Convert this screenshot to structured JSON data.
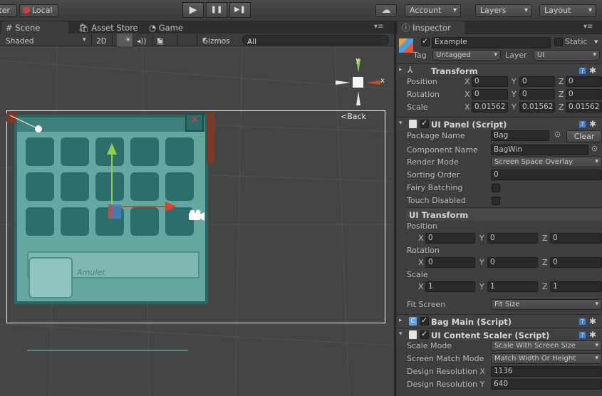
{
  "toolbar": {
    "center_label": "Center",
    "local_label": "Local",
    "play": "▶",
    "pause": "❚❚",
    "step": "▶❚",
    "cloud": "☁",
    "account": "Account",
    "layers": "Layers",
    "layout": "Layout"
  },
  "tabs": {
    "scene": "Scene",
    "asset_store": "Asset Store",
    "game": "Game"
  },
  "scene_bar": {
    "shading": "Shaded",
    "mode_2d": "2D",
    "sun": "☀",
    "audio": "◂))",
    "fx": "▣",
    "gizmos": "Gizmos",
    "search_placeholder": "All"
  },
  "scene": {
    "back_label": "Back",
    "axis_y": "y",
    "axis_x": "x"
  },
  "inspector": {
    "tab": "Inspector",
    "object_name": "Example",
    "static": "Static",
    "tag_label": "Tag",
    "tag_value": "Untagged",
    "layer_label": "Layer",
    "layer_value": "UI",
    "transform": {
      "title": "Transform",
      "position": "Position",
      "rotation": "Rotation",
      "scale": "Scale",
      "pos": [
        "0",
        "0",
        "0"
      ],
      "rot": [
        "0",
        "0",
        "0"
      ],
      "scl": [
        "0.01562",
        "0.01562",
        "0.01562"
      ]
    },
    "ui_panel": {
      "title": "UI Panel (Script)",
      "package_name_label": "Package Name",
      "package_name": "Bag",
      "clear": "Clear",
      "component_name_label": "Component Name",
      "component_name": "BagWin",
      "render_mode_label": "Render Mode",
      "render_mode": "Screen Space Overlay",
      "sorting_order_label": "Sorting Order",
      "sorting_order": "0",
      "fairy_batching": "Fairy Batching",
      "touch_disabled": "Touch Disabled"
    },
    "ui_transform": {
      "title": "UI Transform",
      "position": "Position",
      "rotation": "Rotation",
      "scale": "Scale",
      "pos": [
        "0",
        "0",
        "0"
      ],
      "rot": [
        "0",
        "0",
        "0"
      ],
      "scl": [
        "1",
        "1",
        "1"
      ],
      "fit_screen_label": "Fit Screen",
      "fit_screen": "Fit Size"
    },
    "bag_main": {
      "title": "Bag Main (Script)"
    },
    "content_scaler": {
      "title": "UI Content Scaler (Script)",
      "scale_mode_label": "Scale Mode",
      "scale_mode": "Scale With Screen Size",
      "match_mode_label": "Screen Match Mode",
      "match_mode": "Match Width Or Height",
      "res_x_label": "Design Resolution X",
      "res_x": "1136",
      "res_y_label": "Design Resolution Y",
      "res_y": "640"
    },
    "axes": {
      "x": "X",
      "y": "Y",
      "z": "Z"
    }
  }
}
